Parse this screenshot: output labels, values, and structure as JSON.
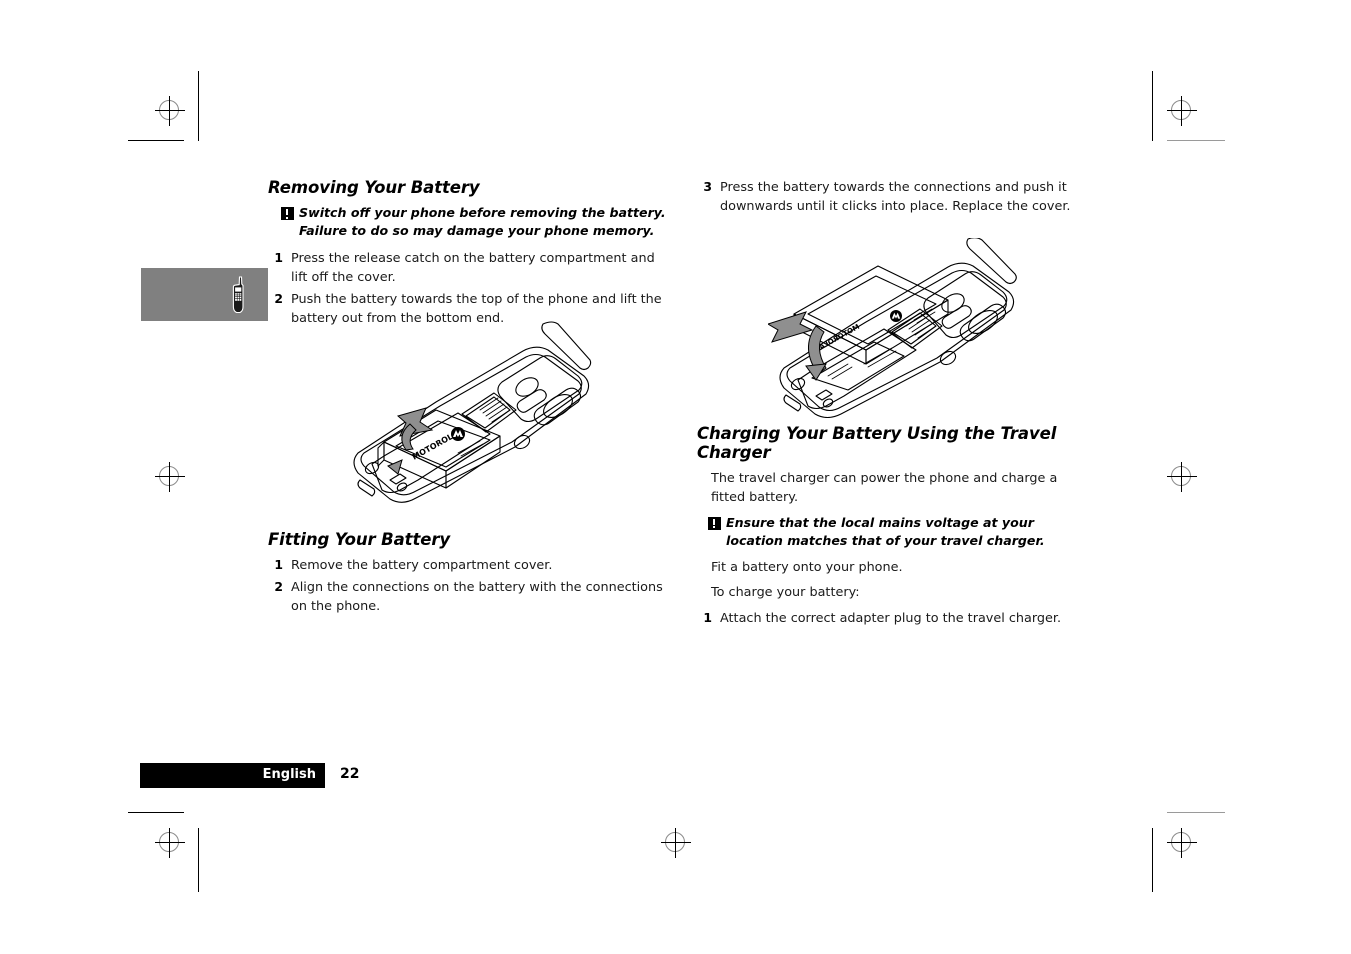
{
  "document": {
    "language_tab": "English",
    "page_number": "22",
    "index_tab_icon": "phone-icon"
  },
  "left_column": {
    "section1": {
      "heading": "Removing Your Battery",
      "warning": {
        "icon": "warning-exclamation-icon",
        "text": "Switch off your phone before removing the battery. Failure to do so may damage your phone memory."
      },
      "steps": [
        {
          "num": "1",
          "text": "Press the release catch on the battery compartment and lift off the cover."
        },
        {
          "num": "2",
          "text": "Push the battery towards the top of the phone and lift the battery out from the bottom end."
        }
      ],
      "illustration": "phone-battery-removal-diagram"
    },
    "section2": {
      "heading": "Fitting Your Battery",
      "steps": [
        {
          "num": "1",
          "text": "Remove the battery compartment cover."
        },
        {
          "num": "2",
          "text": "Align the connections on the battery with the connections on the phone."
        }
      ]
    }
  },
  "right_column": {
    "continued_steps": [
      {
        "num": "3",
        "text": "Press the battery towards the connections and push it downwards until it clicks into place. Replace the cover."
      }
    ],
    "illustration": "phone-battery-fitting-diagram",
    "section3": {
      "heading": "Charging Your Battery Using the Travel Charger",
      "intro": "The travel charger can power the phone and charge a fitted battery.",
      "warning": {
        "icon": "warning-exclamation-icon",
        "text": "Ensure that the local mains voltage at your location matches that of your travel charger."
      },
      "body1": "Fit a battery onto your phone.",
      "body2": "To charge your battery:",
      "steps": [
        {
          "num": "1",
          "text": "Attach the correct adapter plug to the travel charger."
        }
      ]
    }
  },
  "print_marks": {
    "registration_mark_label": "registration-mark",
    "crop_mark_label": "crop-mark"
  },
  "colors": {
    "index_tab_gray": "#808080",
    "footer_black": "#000000",
    "text_black": "#1a1a1a"
  }
}
